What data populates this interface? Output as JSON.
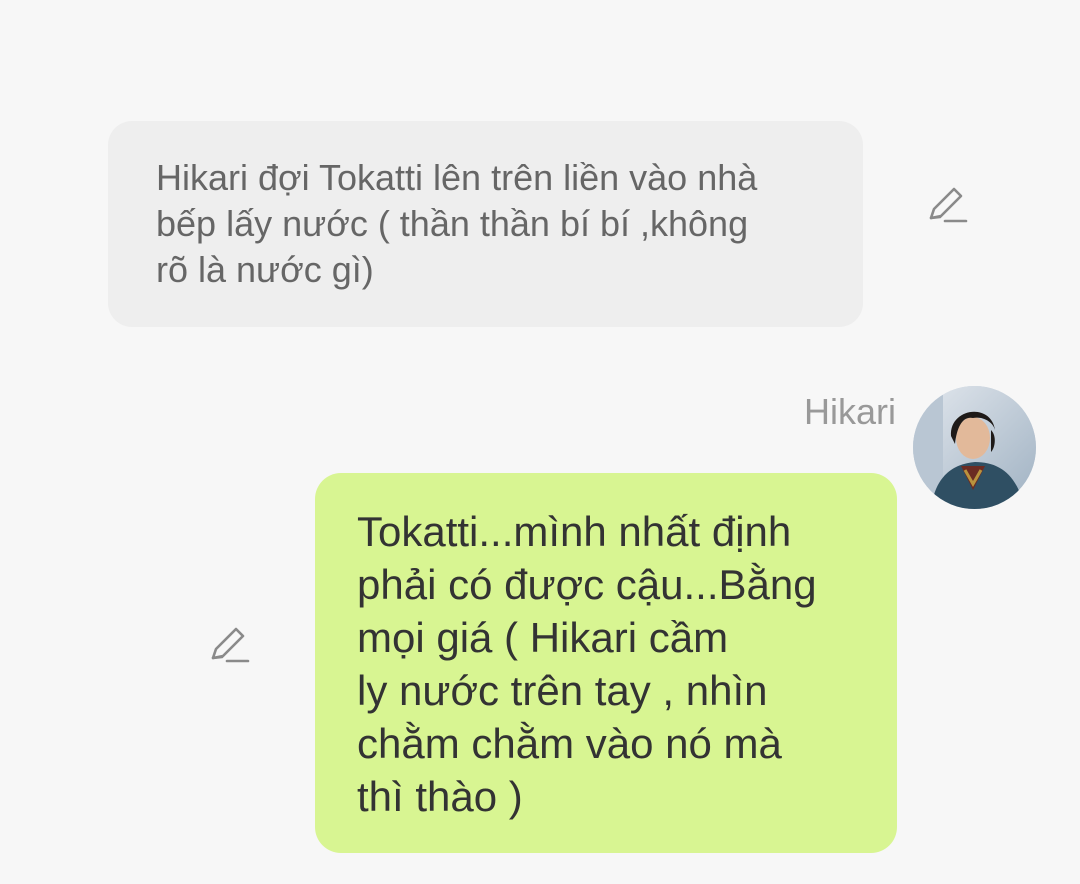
{
  "messages": [
    {
      "type": "narration",
      "text": "Hikari đợi Tokatti lên trên liền vào nhà\nbếp lấy nước ( thần thần bí bí ,không\nrõ là nước gì)",
      "icon": "edit-icon"
    },
    {
      "type": "character",
      "sender": "Hikari",
      "avatar_icon": "avatar-photo",
      "text": "Tokatti...mình nhất định\nphải có được cậu...Bằng\nmọi giá ( Hikari cầm\nly nước trên tay , nhìn\nchằm chằm vào nó mà\nthì thào )",
      "bubble_color": "#d8f592",
      "icon": "edit-icon"
    }
  ],
  "colors": {
    "background": "#f7f7f7",
    "narration_bubble": "#eeeeee",
    "narration_text": "#666666",
    "message_text": "#333333",
    "sender_name": "#999999"
  }
}
